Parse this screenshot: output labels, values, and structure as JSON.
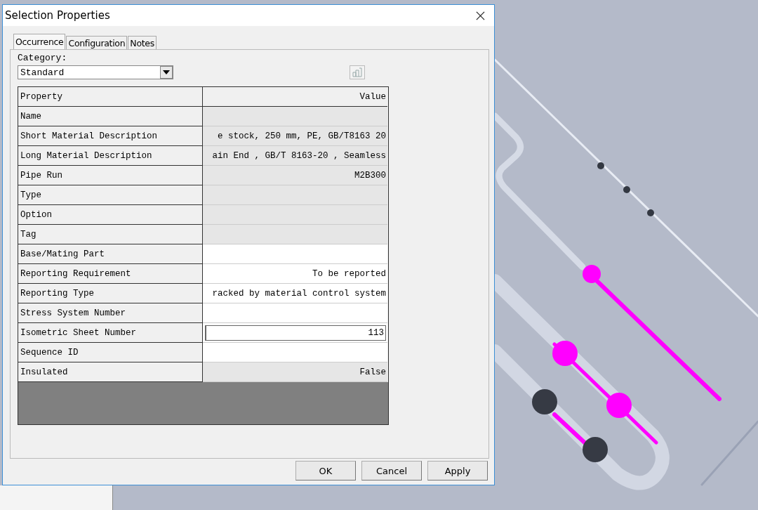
{
  "window": {
    "title": "Selection Properties"
  },
  "tabs": [
    {
      "label": "Occurrence",
      "selected": true
    },
    {
      "label": "Configuration",
      "selected": false
    },
    {
      "label": "Notes",
      "selected": false
    }
  ],
  "category": {
    "label": "Category:",
    "value": "Standard"
  },
  "table": {
    "columns": [
      "Property",
      "Value"
    ],
    "rows": [
      {
        "property": "Name",
        "value": "",
        "editable": false
      },
      {
        "property": "Short Material Description",
        "value": "e stock, 250 mm, PE, GB/T8163 20",
        "editable": false
      },
      {
        "property": "Long Material Description",
        "value": "ain End , GB/T 8163-20 , Seamless",
        "editable": false
      },
      {
        "property": "Pipe Run",
        "value": "M2B300",
        "editable": false
      },
      {
        "property": "Type",
        "value": "",
        "editable": false
      },
      {
        "property": "Option",
        "value": "",
        "editable": false
      },
      {
        "property": "Tag",
        "value": "",
        "editable": false
      },
      {
        "property": "Base/Mating Part",
        "value": "",
        "editable": true
      },
      {
        "property": "Reporting Requirement",
        "value": "To be reported",
        "editable": true
      },
      {
        "property": "Reporting Type",
        "value": "racked by material control system",
        "editable": true
      },
      {
        "property": "Stress System Number",
        "value": "",
        "editable": true
      },
      {
        "property": "Isometric Sheet Number",
        "value": "113",
        "editable": true,
        "kind": "input"
      },
      {
        "property": "Sequence ID",
        "value": "",
        "editable": true
      },
      {
        "property": "Insulated",
        "value": "False",
        "editable": false
      }
    ]
  },
  "buttons": [
    "OK",
    "Cancel",
    "Apply"
  ]
}
